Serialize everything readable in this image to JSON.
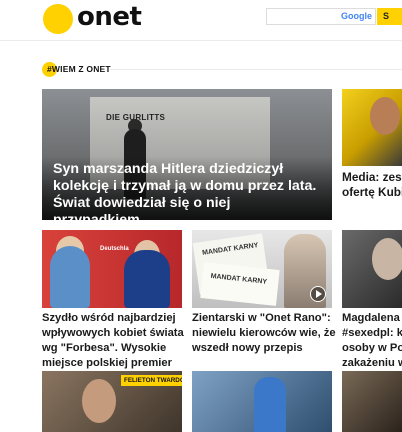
{
  "header": {
    "logo_text": "onet",
    "search": {
      "placeholder": "",
      "brand_prefix": "",
      "brand": "Google",
      "button_label": "S"
    }
  },
  "section": {
    "label": "#WIEM Z ONET"
  },
  "hero": {
    "title": "Syn marszanda Hitlera dziedziczył kolekcję i trzymał ją w domu przez lata. Świat dowiedział się o niej przypadkiem",
    "image_text": "DIE GURLITTS"
  },
  "side_teaser": {
    "title_line1": "Media: zespół",
    "title_line2": "ofertę Kubicy"
  },
  "row2": [
    {
      "title": "Szydło wśród najbardziej wpływowych kobiet świata wg \"Forbesa\". Wysokie miejsce polskiej premier",
      "image_text": "Deutschla"
    },
    {
      "title": "Zientarski w \"Onet Rano\": niewielu kierowców wie, że wszedł nowy przepis",
      "image_text_1": "MANDAT KARNY",
      "image_text_2": "MANDAT KARNY",
      "has_video": true
    },
    {
      "title_lines": [
        "Magdalena Cie",
        "#sexedpl: każ",
        "osoby w Polsc",
        "zakażeniu wir"
      ]
    }
  ],
  "row3": [
    {
      "tag": "FELIETON TWARDOCHA"
    }
  ],
  "colors": {
    "accent": "#ffd100",
    "text": "#1a1a1a"
  }
}
